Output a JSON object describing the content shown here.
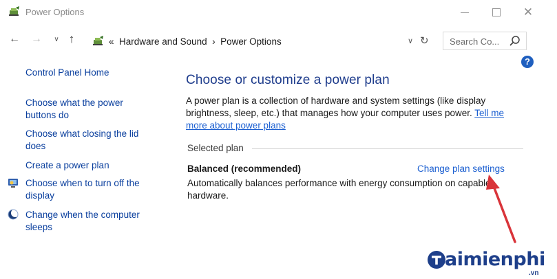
{
  "window": {
    "title": "Power Options",
    "minimize_label": "—",
    "close_label": "✕"
  },
  "nav": {
    "back_label": "←",
    "forward_label": "→",
    "recent_label": "∨",
    "up_label": "↑",
    "breadcrumb_prefix": "«",
    "breadcrumb": [
      "Hardware and Sound",
      "Power Options"
    ],
    "breadcrumb_separator": "›",
    "dropdown_label": "∨",
    "refresh_label": "↻",
    "search_placeholder": "Search Co..."
  },
  "help": {
    "label": "?"
  },
  "sidebar": {
    "home": "Control Panel Home",
    "items": [
      {
        "label": "Choose what the power buttons do",
        "icon": null
      },
      {
        "label": "Choose what closing the lid does",
        "icon": null
      },
      {
        "label": "Create a power plan",
        "icon": null
      },
      {
        "label": "Choose when to turn off the display",
        "icon": "monitor-icon"
      },
      {
        "label": "Change when the computer sleeps",
        "icon": "sleep-moon-icon"
      }
    ]
  },
  "main": {
    "heading": "Choose or customize a power plan",
    "description": "A power plan is a collection of hardware and system settings (like display brightness, sleep, etc.) that manages how your computer uses power.",
    "learn_more_link": "Tell me more about power plans",
    "selected_plan_label": "Selected plan",
    "plan": {
      "name": "Balanced (recommended)",
      "settings_link": "Change plan settings",
      "description": "Automatically balances performance with energy consumption on capable hardware."
    }
  },
  "watermark": {
    "text": "aimienphi",
    "suffix": ".vn"
  },
  "colors": {
    "link": "#0a3f9e",
    "heading": "#1e3c8c",
    "annotation_arrow": "#d9343a",
    "watermark": "#1e3f8a"
  }
}
